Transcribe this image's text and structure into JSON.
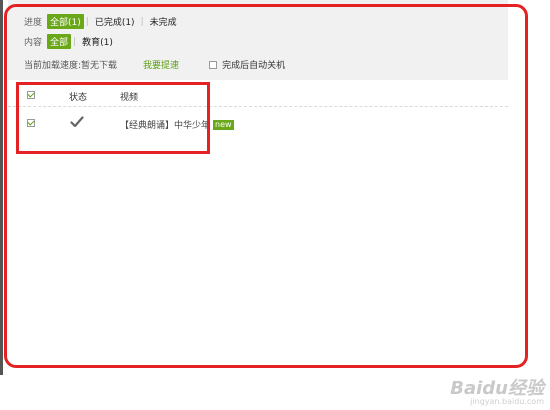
{
  "filters": {
    "progress_label": "进度",
    "progress_all": "全部(1)",
    "progress_done": "已完成(1)",
    "progress_undone": "未完成",
    "content_label": "内容",
    "content_all": "全部",
    "content_edu": "教育(1)",
    "separator": "|"
  },
  "speed": {
    "text": "当前加载速度:暂无下载",
    "boost": "我要提速",
    "auto_shutdown": "完成后自动关机"
  },
  "table": {
    "col_status": "状态",
    "col_video": "视频",
    "items": [
      {
        "title": "【经典朗诵】中华少年",
        "badge": "new"
      }
    ]
  },
  "watermark": {
    "logo": "Baidu经验",
    "url": "jingyan.baidu.com"
  },
  "colors": {
    "accent_green": "#6aa81a",
    "highlight_red": "#e52223",
    "filter_bg": "#f1f1f1"
  }
}
